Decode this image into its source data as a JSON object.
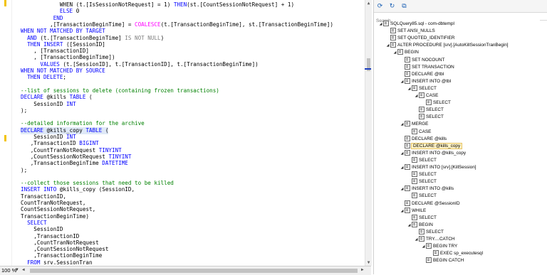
{
  "editor": {
    "lines": [
      {
        "indent": 12,
        "parts": [
          [
            "",
            "WHEN ("
          ],
          [
            "",
            "t.[IsSessionNotRequest] = 1) "
          ],
          [
            "kw",
            "THEN"
          ],
          [
            "",
            "(st.[CountSessionNotRequest] + 1)"
          ]
        ]
      },
      {
        "indent": 12,
        "parts": [
          [
            "kw",
            "ELSE"
          ],
          [
            "",
            " 0"
          ]
        ]
      },
      {
        "indent": 10,
        "parts": [
          [
            "kw",
            "END"
          ]
        ]
      },
      {
        "indent": 9,
        "parts": [
          [
            "",
            ",[TransactionBeginTime] = "
          ],
          [
            "fn",
            "COALESCE"
          ],
          [
            "",
            "(t.[TransactionBeginTime], st.[TransactionBeginTime])"
          ]
        ]
      },
      {
        "indent": 0,
        "parts": [
          [
            "kw",
            "WHEN NOT MATCHED BY TARGET"
          ]
        ]
      },
      {
        "indent": 2,
        "parts": [
          [
            "kw",
            "AND"
          ],
          [
            "",
            " (t.[TransactionBeginTime] "
          ],
          [
            "gr",
            "IS NOT NULL"
          ],
          [
            "",
            ")"
          ]
        ]
      },
      {
        "indent": 2,
        "parts": [
          [
            "kw",
            "THEN INSERT"
          ],
          [
            "",
            " ([SessionID]"
          ]
        ]
      },
      {
        "indent": 4,
        "parts": [
          [
            "",
            ", [TransactionID]"
          ]
        ]
      },
      {
        "indent": 4,
        "parts": [
          [
            "",
            ", [TransactionBeginTime])"
          ]
        ]
      },
      {
        "indent": 6,
        "parts": [
          [
            "kw",
            "VALUES"
          ],
          [
            "",
            " (t.[SessionID], t.[TransactionID], t.[TransactionBeginTime])"
          ]
        ]
      },
      {
        "indent": 0,
        "parts": [
          [
            "kw",
            "WHEN NOT MATCHED BY SOURCE"
          ]
        ]
      },
      {
        "indent": 2,
        "parts": [
          [
            "kw",
            "THEN DELETE"
          ],
          [
            "",
            ";"
          ]
        ]
      },
      {
        "indent": 0,
        "parts": []
      },
      {
        "indent": 0,
        "parts": [
          [
            "cm",
            "--list of sessions to delete (containing frozen transactions)"
          ]
        ]
      },
      {
        "indent": 0,
        "parts": [
          [
            "kw",
            "DECLARE"
          ],
          [
            "",
            " @kills "
          ],
          [
            "kw",
            "TABLE"
          ],
          [
            "",
            " ("
          ]
        ]
      },
      {
        "indent": 4,
        "parts": [
          [
            "",
            "SessionID "
          ],
          [
            "kw",
            "INT"
          ]
        ]
      },
      {
        "indent": 0,
        "parts": [
          [
            "",
            ");"
          ]
        ]
      },
      {
        "indent": 0,
        "parts": []
      },
      {
        "indent": 0,
        "parts": [
          [
            "cm",
            "--detailed information for the archive"
          ]
        ]
      },
      {
        "indent": 0,
        "parts": [
          [
            "kw",
            "DECLARE"
          ],
          [
            "",
            " @kills_copy "
          ],
          [
            "kw",
            "TABLE"
          ],
          [
            "",
            " ("
          ]
        ],
        "hl": true
      },
      {
        "indent": 4,
        "parts": [
          [
            "",
            "SessionID "
          ],
          [
            "kw",
            "INT"
          ]
        ]
      },
      {
        "indent": 3,
        "parts": [
          [
            "",
            ",TransactionID "
          ],
          [
            "kw",
            "BIGINT"
          ]
        ]
      },
      {
        "indent": 3,
        "parts": [
          [
            "",
            ",CountTranNotRequest "
          ],
          [
            "kw",
            "TINYINT"
          ]
        ]
      },
      {
        "indent": 3,
        "parts": [
          [
            "",
            ",CountSessionNotRequest "
          ],
          [
            "kw",
            "TINYINT"
          ]
        ]
      },
      {
        "indent": 3,
        "parts": [
          [
            "",
            ",TransactionBeginTime "
          ],
          [
            "kw",
            "DATETIME"
          ]
        ]
      },
      {
        "indent": 0,
        "parts": [
          [
            "",
            ");"
          ]
        ]
      },
      {
        "indent": 0,
        "parts": []
      },
      {
        "indent": 0,
        "parts": [
          [
            "cm",
            "--collect those sessions that need to be killed"
          ]
        ]
      },
      {
        "indent": 0,
        "parts": [
          [
            "kw",
            "INSERT INTO"
          ],
          [
            "",
            " @kills_copy (SessionID,"
          ]
        ]
      },
      {
        "indent": 0,
        "parts": [
          [
            "",
            "TransactionID,"
          ]
        ]
      },
      {
        "indent": 0,
        "parts": [
          [
            "",
            "CountTranNotRequest,"
          ]
        ]
      },
      {
        "indent": 0,
        "parts": [
          [
            "",
            "CountSessionNotRequest,"
          ]
        ]
      },
      {
        "indent": 0,
        "parts": [
          [
            "",
            "TransactionBeginTime)"
          ]
        ]
      },
      {
        "indent": 2,
        "parts": [
          [
            "kw",
            "SELECT"
          ]
        ]
      },
      {
        "indent": 4,
        "parts": [
          [
            "",
            "SessionID"
          ]
        ]
      },
      {
        "indent": 4,
        "parts": [
          [
            "",
            ",TransactionID"
          ]
        ]
      },
      {
        "indent": 4,
        "parts": [
          [
            "",
            ",CountTranNotRequest"
          ]
        ]
      },
      {
        "indent": 4,
        "parts": [
          [
            "",
            ",CountSessionNotRequest"
          ]
        ]
      },
      {
        "indent": 4,
        "parts": [
          [
            "",
            ",TransactionBeginTime"
          ]
        ]
      },
      {
        "indent": 2,
        "parts": [
          [
            "kw",
            "FROM"
          ],
          [
            "",
            " srv.SessionTran"
          ]
        ]
      }
    ]
  },
  "statusbar": {
    "zoom": "100 %"
  },
  "panel": {
    "search_placeholder": "Search",
    "tree": [
      {
        "depth": 0,
        "label": "SQLQuery85.sql - com-dbtempl",
        "exp": true
      },
      {
        "depth": 1,
        "label": "SET ANSI_NULLS"
      },
      {
        "depth": 1,
        "label": "SET QUOTED_IDENTIFIER"
      },
      {
        "depth": 1,
        "label": "ALTER PROCEDURE [srv].[AutoKillSessionTranBegin]",
        "exp": true
      },
      {
        "depth": 2,
        "label": "BEGIN",
        "exp": true
      },
      {
        "depth": 3,
        "label": "SET NOCOUNT"
      },
      {
        "depth": 3,
        "label": "SET TRANSACTION"
      },
      {
        "depth": 3,
        "label": "DECLARE @tbl"
      },
      {
        "depth": 3,
        "label": "INSERT INTO @tbl",
        "exp": true
      },
      {
        "depth": 4,
        "label": "SELECT",
        "exp": true
      },
      {
        "depth": 5,
        "label": "CASE",
        "exp": true
      },
      {
        "depth": 6,
        "label": "SELECT"
      },
      {
        "depth": 5,
        "label": "SELECT"
      },
      {
        "depth": 5,
        "label": "SELECT"
      },
      {
        "depth": 3,
        "label": "MERGE",
        "exp": true
      },
      {
        "depth": 4,
        "label": "CASE"
      },
      {
        "depth": 3,
        "label": "DECLARE @kills"
      },
      {
        "depth": 3,
        "label": "DECLARE @kills_copy",
        "sel": true
      },
      {
        "depth": 3,
        "label": "INSERT INTO @kills_copy",
        "exp": true
      },
      {
        "depth": 4,
        "label": "SELECT"
      },
      {
        "depth": 3,
        "label": "INSERT INTO [srv].[KillSession]",
        "exp": true
      },
      {
        "depth": 4,
        "label": "SELECT"
      },
      {
        "depth": 4,
        "label": "SELECT"
      },
      {
        "depth": 3,
        "label": "INSERT INTO @kills",
        "exp": true
      },
      {
        "depth": 4,
        "label": "SELECT"
      },
      {
        "depth": 3,
        "label": "DECLARE @SessionID"
      },
      {
        "depth": 3,
        "label": "WHILE",
        "exp": true
      },
      {
        "depth": 4,
        "label": "SELECT"
      },
      {
        "depth": 4,
        "label": "BEGIN",
        "exp": true
      },
      {
        "depth": 5,
        "label": "SELECT"
      },
      {
        "depth": 5,
        "label": "TRY....CATCH",
        "exp": true
      },
      {
        "depth": 6,
        "label": "BEGIN TRY",
        "exp": true
      },
      {
        "depth": 7,
        "label": "EXEC sp_executesql"
      },
      {
        "depth": 6,
        "label": "BEGIN CATCH"
      }
    ]
  }
}
